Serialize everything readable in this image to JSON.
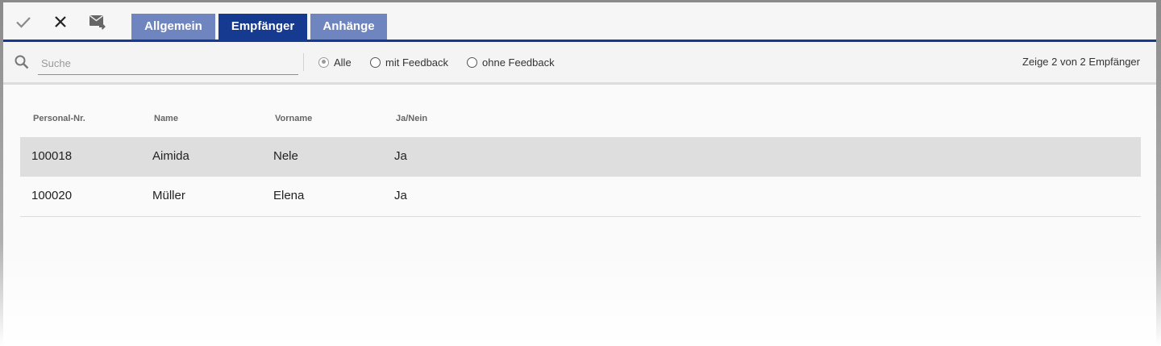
{
  "toolbar": {
    "icons": [
      "check-icon",
      "close-icon",
      "mail-forward-icon"
    ]
  },
  "tabs": [
    {
      "label": "Allgemein",
      "active": false
    },
    {
      "label": "Empfänger",
      "active": true
    },
    {
      "label": "Anhänge",
      "active": false
    }
  ],
  "colors": {
    "accent": "#173a91",
    "tab_inactive": "#6f85c0",
    "row_selected": "#dedede"
  },
  "filter": {
    "search_placeholder": "Suche",
    "search_value": "",
    "options": [
      {
        "label": "Alle",
        "checked": true
      },
      {
        "label": "mit Feedback",
        "checked": false
      },
      {
        "label": "ohne Feedback",
        "checked": false
      }
    ],
    "count_text": "Zeige 2 von 2 Empfänger"
  },
  "table": {
    "headers": [
      "Personal-Nr.",
      "Name",
      "Vorname",
      "Ja/Nein"
    ],
    "rows": [
      {
        "cells": [
          "100018",
          "Aimida",
          "Nele",
          "Ja"
        ],
        "selected": true
      },
      {
        "cells": [
          "100020",
          "Müller",
          "Elena",
          "Ja"
        ],
        "selected": false
      }
    ]
  }
}
